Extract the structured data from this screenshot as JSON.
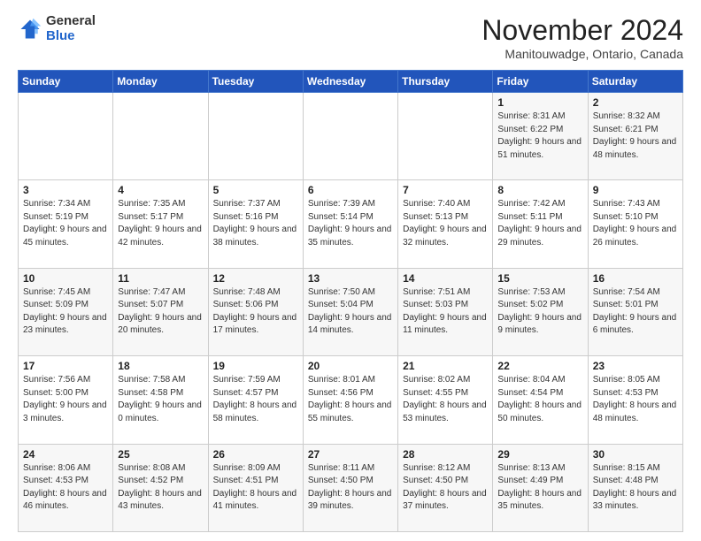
{
  "logo": {
    "general": "General",
    "blue": "Blue"
  },
  "title": "November 2024",
  "location": "Manitouwadge, Ontario, Canada",
  "days_header": [
    "Sunday",
    "Monday",
    "Tuesday",
    "Wednesday",
    "Thursday",
    "Friday",
    "Saturday"
  ],
  "weeks": [
    [
      {
        "day": "",
        "info": ""
      },
      {
        "day": "",
        "info": ""
      },
      {
        "day": "",
        "info": ""
      },
      {
        "day": "",
        "info": ""
      },
      {
        "day": "",
        "info": ""
      },
      {
        "day": "1",
        "info": "Sunrise: 8:31 AM\nSunset: 6:22 PM\nDaylight: 9 hours and 51 minutes."
      },
      {
        "day": "2",
        "info": "Sunrise: 8:32 AM\nSunset: 6:21 PM\nDaylight: 9 hours and 48 minutes."
      }
    ],
    [
      {
        "day": "3",
        "info": "Sunrise: 7:34 AM\nSunset: 5:19 PM\nDaylight: 9 hours and 45 minutes."
      },
      {
        "day": "4",
        "info": "Sunrise: 7:35 AM\nSunset: 5:17 PM\nDaylight: 9 hours and 42 minutes."
      },
      {
        "day": "5",
        "info": "Sunrise: 7:37 AM\nSunset: 5:16 PM\nDaylight: 9 hours and 38 minutes."
      },
      {
        "day": "6",
        "info": "Sunrise: 7:39 AM\nSunset: 5:14 PM\nDaylight: 9 hours and 35 minutes."
      },
      {
        "day": "7",
        "info": "Sunrise: 7:40 AM\nSunset: 5:13 PM\nDaylight: 9 hours and 32 minutes."
      },
      {
        "day": "8",
        "info": "Sunrise: 7:42 AM\nSunset: 5:11 PM\nDaylight: 9 hours and 29 minutes."
      },
      {
        "day": "9",
        "info": "Sunrise: 7:43 AM\nSunset: 5:10 PM\nDaylight: 9 hours and 26 minutes."
      }
    ],
    [
      {
        "day": "10",
        "info": "Sunrise: 7:45 AM\nSunset: 5:09 PM\nDaylight: 9 hours and 23 minutes."
      },
      {
        "day": "11",
        "info": "Sunrise: 7:47 AM\nSunset: 5:07 PM\nDaylight: 9 hours and 20 minutes."
      },
      {
        "day": "12",
        "info": "Sunrise: 7:48 AM\nSunset: 5:06 PM\nDaylight: 9 hours and 17 minutes."
      },
      {
        "day": "13",
        "info": "Sunrise: 7:50 AM\nSunset: 5:04 PM\nDaylight: 9 hours and 14 minutes."
      },
      {
        "day": "14",
        "info": "Sunrise: 7:51 AM\nSunset: 5:03 PM\nDaylight: 9 hours and 11 minutes."
      },
      {
        "day": "15",
        "info": "Sunrise: 7:53 AM\nSunset: 5:02 PM\nDaylight: 9 hours and 9 minutes."
      },
      {
        "day": "16",
        "info": "Sunrise: 7:54 AM\nSunset: 5:01 PM\nDaylight: 9 hours and 6 minutes."
      }
    ],
    [
      {
        "day": "17",
        "info": "Sunrise: 7:56 AM\nSunset: 5:00 PM\nDaylight: 9 hours and 3 minutes."
      },
      {
        "day": "18",
        "info": "Sunrise: 7:58 AM\nSunset: 4:58 PM\nDaylight: 9 hours and 0 minutes."
      },
      {
        "day": "19",
        "info": "Sunrise: 7:59 AM\nSunset: 4:57 PM\nDaylight: 8 hours and 58 minutes."
      },
      {
        "day": "20",
        "info": "Sunrise: 8:01 AM\nSunset: 4:56 PM\nDaylight: 8 hours and 55 minutes."
      },
      {
        "day": "21",
        "info": "Sunrise: 8:02 AM\nSunset: 4:55 PM\nDaylight: 8 hours and 53 minutes."
      },
      {
        "day": "22",
        "info": "Sunrise: 8:04 AM\nSunset: 4:54 PM\nDaylight: 8 hours and 50 minutes."
      },
      {
        "day": "23",
        "info": "Sunrise: 8:05 AM\nSunset: 4:53 PM\nDaylight: 8 hours and 48 minutes."
      }
    ],
    [
      {
        "day": "24",
        "info": "Sunrise: 8:06 AM\nSunset: 4:53 PM\nDaylight: 8 hours and 46 minutes."
      },
      {
        "day": "25",
        "info": "Sunrise: 8:08 AM\nSunset: 4:52 PM\nDaylight: 8 hours and 43 minutes."
      },
      {
        "day": "26",
        "info": "Sunrise: 8:09 AM\nSunset: 4:51 PM\nDaylight: 8 hours and 41 minutes."
      },
      {
        "day": "27",
        "info": "Sunrise: 8:11 AM\nSunset: 4:50 PM\nDaylight: 8 hours and 39 minutes."
      },
      {
        "day": "28",
        "info": "Sunrise: 8:12 AM\nSunset: 4:50 PM\nDaylight: 8 hours and 37 minutes."
      },
      {
        "day": "29",
        "info": "Sunrise: 8:13 AM\nSunset: 4:49 PM\nDaylight: 8 hours and 35 minutes."
      },
      {
        "day": "30",
        "info": "Sunrise: 8:15 AM\nSunset: 4:48 PM\nDaylight: 8 hours and 33 minutes."
      }
    ]
  ]
}
